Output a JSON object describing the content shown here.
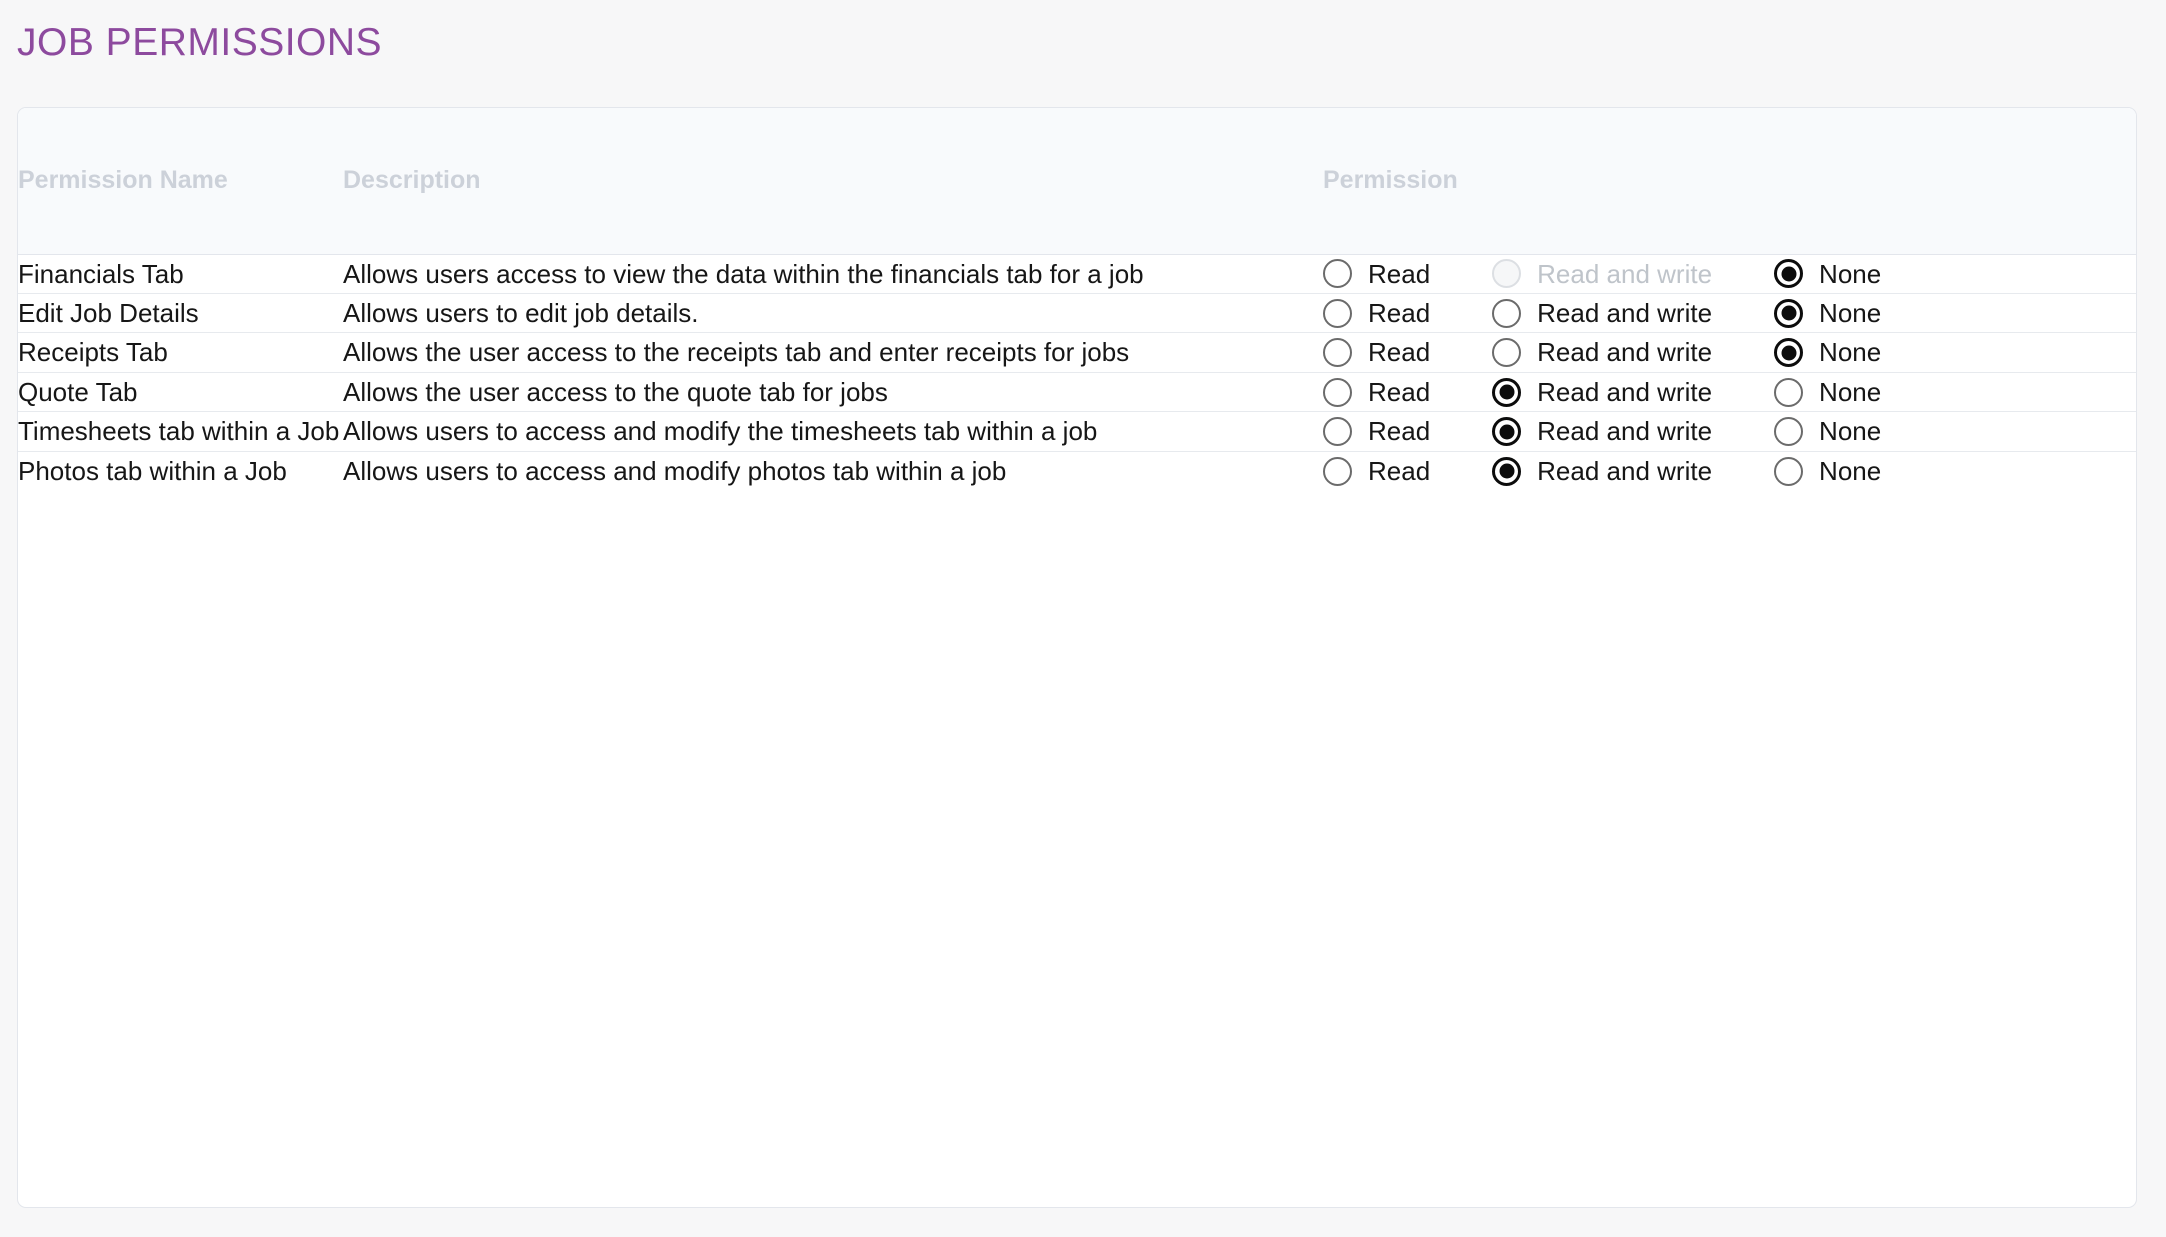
{
  "page": {
    "title": "JOB PERMISSIONS",
    "title_color": "#8d4a9e",
    "background": "#f7f7f8"
  },
  "table": {
    "headers": {
      "name": "Permission Name",
      "description": "Description",
      "permission": "Permission"
    },
    "option_labels": {
      "read": "Read",
      "read_write": "Read and write",
      "none": "None"
    },
    "rows": [
      {
        "name": "Financials Tab",
        "description": "Allows users access to view the data within the financials tab for a job",
        "selected": "none",
        "disabled": [
          "read_write"
        ]
      },
      {
        "name": "Edit Job Details",
        "description": "Allows users to edit job details.",
        "selected": "none",
        "disabled": []
      },
      {
        "name": "Receipts Tab",
        "description": "Allows the user access to the receipts tab and enter receipts for jobs",
        "selected": "none",
        "disabled": []
      },
      {
        "name": "Quote Tab",
        "description": "Allows the user access to the quote tab for jobs",
        "selected": "read_write",
        "disabled": []
      },
      {
        "name": "Timesheets tab within a Job",
        "description": "Allows users to access and modify the timesheets tab within a job",
        "selected": "read_write",
        "disabled": []
      },
      {
        "name": "Photos tab within a Job",
        "description": "Allows users to access and modify photos tab within a job",
        "selected": "read_write",
        "disabled": []
      }
    ]
  }
}
